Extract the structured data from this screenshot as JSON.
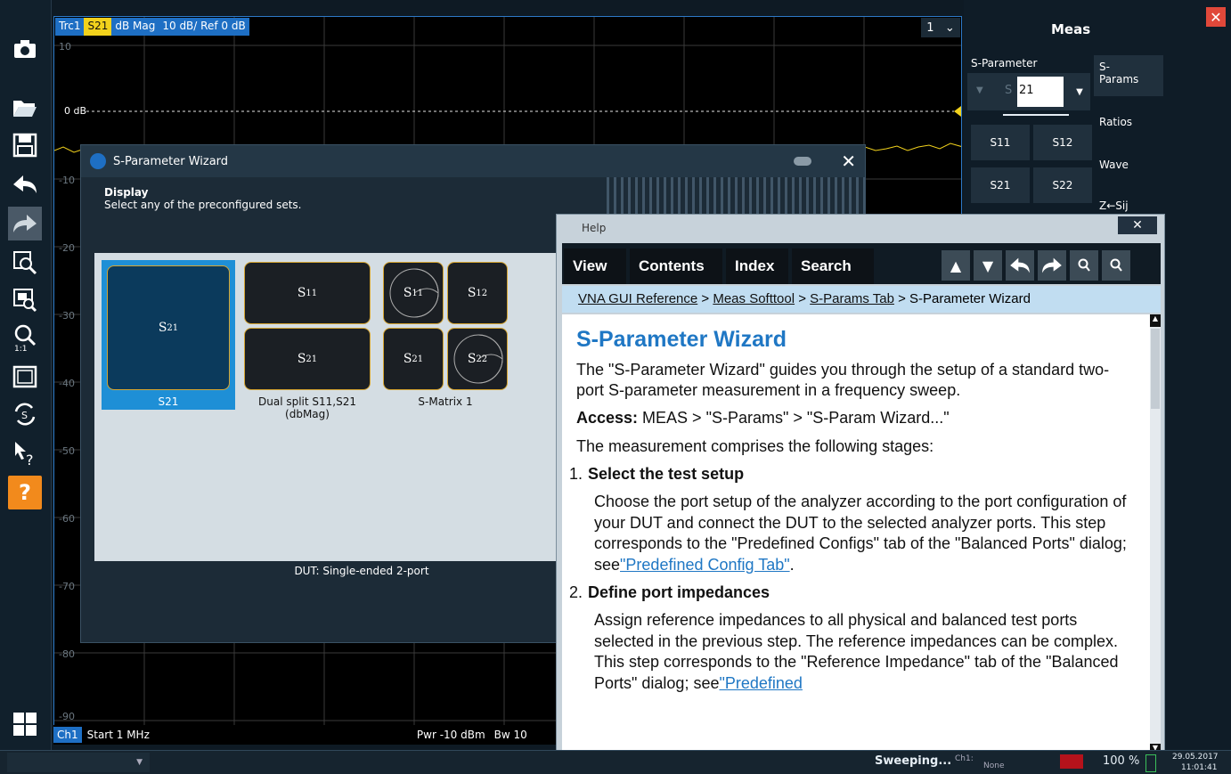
{
  "trace": {
    "trc": "Trc1",
    "param": "S21",
    "format": "dB Mag",
    "scale": "10 dB/ Ref 0 dB"
  },
  "channel_selector": "1",
  "ref_label": "0 dB",
  "y_labels": [
    "10",
    "-10",
    "-20",
    "-30",
    "-40",
    "-50",
    "-60",
    "-70",
    "-80",
    "-90"
  ],
  "channel_footer": {
    "ch": "Ch1",
    "start": "Start  1 MHz",
    "pwr": "Pwr  -10 dBm",
    "bw": "Bw  10"
  },
  "meas_panel": {
    "title": "Meas",
    "sparam_label": "S-Parameter",
    "sparam_value": "21",
    "sparam_prefix": "S",
    "buttons": [
      "S11",
      "S12",
      "S21",
      "S22"
    ],
    "tabs": [
      "S-\nParams",
      "Ratios",
      "Wave",
      "Z←Sij"
    ]
  },
  "wizard": {
    "title": "S-Parameter Wizard",
    "section": "Display",
    "instruction": "Select any of the preconfigured sets.",
    "tiles": {
      "s21": "S",
      "dual_top": "S",
      "dual_bottom": "S",
      "matrix": [
        "S",
        "S",
        "S",
        "S"
      ]
    },
    "subscripts": {
      "s21": "21",
      "dual_top": "11",
      "dual_bottom": "21",
      "matrix": [
        "11",
        "12",
        "21",
        "22"
      ]
    },
    "captions": {
      "s21": "S21",
      "dual": "Dual split S11,S21\n(dbMag)",
      "matrix": "S-Matrix 1"
    },
    "dut": "DUT: Single-ended 2-port"
  },
  "help": {
    "window_title": "Help",
    "tabs": [
      "View",
      "Contents",
      "Index",
      "Search"
    ],
    "breadcrumb": [
      "VNA GUI Reference",
      "Meas Softtool",
      "S-Params Tab",
      "S-Parameter Wizard"
    ],
    "heading": "S-Parameter Wizard",
    "intro": "The \"S-Parameter Wizard\" guides you through the setup of a standard two-port S-parameter measurement in a frequency sweep.",
    "access_label": "Access:",
    "access_text": " MEAS > \"S-Params\" > \"S-Param Wizard...\"",
    "comprises": "The measurement comprises the following stages:",
    "step1_num": "1.",
    "step1_title": "Select the test setup",
    "step1_text": "Choose the port setup of the analyzer according to the port configuration of your DUT and connect the DUT to the selected analyzer ports. This step corresponds to the \"Predefined Configs\" tab of the \"Balanced Ports\" dialog; see",
    "step1_link": "\"Predefined Config Tab\"",
    "step2_num": "2.",
    "step2_title": "Define port impedances",
    "step2_text": "Assign reference impedances to all physical and balanced test ports selected in the previous step. The reference impedances can be complex. This step corresponds to the \"Reference Impedance\" tab of the \"Balanced Ports\" dialog; see",
    "step2_link": "\"Predefined"
  },
  "status": {
    "sweeping": "Sweeping...",
    "ch": "Ch1:",
    "none": "None",
    "zoom": "100 %",
    "date": "29.05.2017",
    "time": "11:01:41"
  },
  "icons": [
    "camera-icon",
    "folder-open-icon",
    "save-icon",
    "undo-icon",
    "redo-icon",
    "zoom-icon",
    "zoom-window-icon",
    "zoom-1to1-icon",
    "fullscreen-icon",
    "sweep-icon",
    "pointer-help-icon",
    "help-icon",
    "windows-icon"
  ]
}
